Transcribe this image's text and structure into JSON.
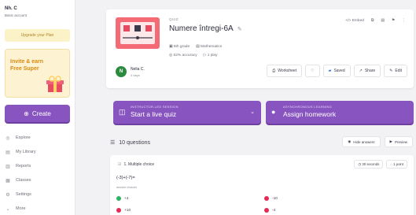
{
  "sidebar": {
    "user_name": "Nh. C",
    "user_sub": "Basic account",
    "upgrade_label": "Upgrade your Plan",
    "invite_text": "Invite & earn Free Super",
    "create_label": "Create",
    "nav": [
      {
        "icon": "explore-icon",
        "label": "Explore"
      },
      {
        "icon": "library-icon",
        "label": "My Library"
      },
      {
        "icon": "reports-icon",
        "label": "Reports"
      },
      {
        "icon": "classes-icon",
        "label": "Classes"
      },
      {
        "icon": "settings-icon",
        "label": "Settings"
      },
      {
        "icon": "more-icon",
        "label": "More"
      }
    ]
  },
  "quiz": {
    "kind": "QUIZ",
    "title": "Numere întregi-6A",
    "grade": "6th grade",
    "subject": "Mathematics",
    "accuracy": "62% accuracy",
    "plays": "1 play",
    "embed_label": "Embed",
    "author": "Nelia C.",
    "author_sub": "4 days",
    "worksheet_label": "Worksheet",
    "saved_label": "Saved",
    "share_label": "Share",
    "edit_label": "Edit"
  },
  "live": {
    "sub": "INSTRUCTOR-LED SESSION",
    "main": "Start a live quiz"
  },
  "homework": {
    "sub": "ASYNCHRONOUS LEARNING",
    "main": "Assign homework"
  },
  "questions": {
    "count_label": "10 questions",
    "hide_answers_label": "Hide answers",
    "preview_label": "Preview"
  },
  "question1": {
    "type": "1. Multiple choice",
    "time": "30 seconds",
    "points": "1 point",
    "text": "(-3)+(-7)=",
    "choices_label": "answer choices",
    "choices": [
      "+4",
      "-10",
      "+10",
      "-4"
    ]
  },
  "colors": {
    "accent": "#8854c0",
    "correct": "#2fb36a",
    "wrong": "#e22c55"
  }
}
